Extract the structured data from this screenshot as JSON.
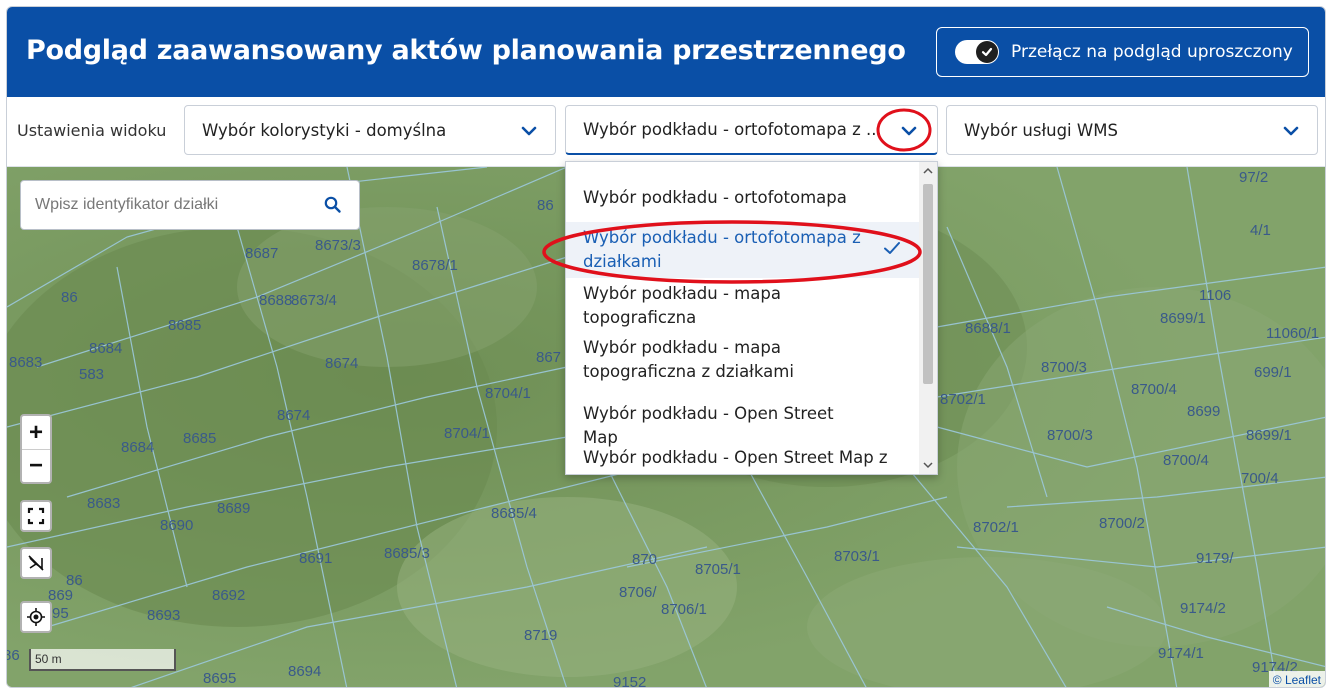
{
  "header": {
    "title": "Podgląd zaawansowany aktów planowania przestrzennego",
    "switch_label": "Przełącz na podgląd uproszczony"
  },
  "toolbar": {
    "label": "Ustawienia widoku",
    "color_select": "Wybór kolorystyki - domyślna",
    "basemap_select": "Wybór podkładu - ortofotomapa z ...",
    "wms_select": "Wybór usługi WMS"
  },
  "dropdown": {
    "options": [
      {
        "label": "Wybór podkładu - ortofotomapa"
      },
      {
        "label": "Wybór podkładu - ortofotomapa z działkami",
        "selected": true
      },
      {
        "label": "Wybór podkładu - mapa topograficzna"
      },
      {
        "label": "Wybór podkładu - mapa topograficzna z działkami"
      },
      {
        "label": "Wybór podkładu - Open Street Map"
      },
      {
        "label": "Wybór podkładu - Open Street Map z"
      }
    ]
  },
  "search": {
    "placeholder": "Wpisz identyfikator działki"
  },
  "map": {
    "zoom_in": "+",
    "zoom_out": "−",
    "scale": "50 m",
    "attribution": "© Leaflet",
    "parcel_labels": [
      "8687",
      "8673/3",
      "8678/1",
      "86",
      "8688",
      "8673/4",
      "8685",
      "8684",
      "8683",
      "583",
      "8674",
      "867",
      "8704/1",
      "8674",
      "8685",
      "8704/1",
      "8684",
      "8683",
      "8689",
      "8690",
      "8685/4",
      "8691",
      "8685/3",
      "870",
      "8705/1",
      "8703/1",
      "86",
      "869",
      "95",
      "8692",
      "8706/",
      "8706/1",
      "8693",
      "8719",
      "86",
      "8694",
      "8695",
      "9152",
      "97/2",
      "4/1",
      "1106",
      "8699/1",
      "11060/1",
      "8688/1",
      "8700/3",
      "699/1",
      "8702/1",
      "8700/4",
      "8699",
      "8700/3",
      "8699/1",
      "8700/4",
      "700/4",
      "8702/1",
      "8700/2",
      "9179/",
      "9174/2",
      "9174/1",
      "9174/2",
      "86"
    ]
  },
  "colors": {
    "header_bg": "#0a4fa6",
    "selected_text": "#1a5fb4",
    "annotation": "#e0101b"
  }
}
